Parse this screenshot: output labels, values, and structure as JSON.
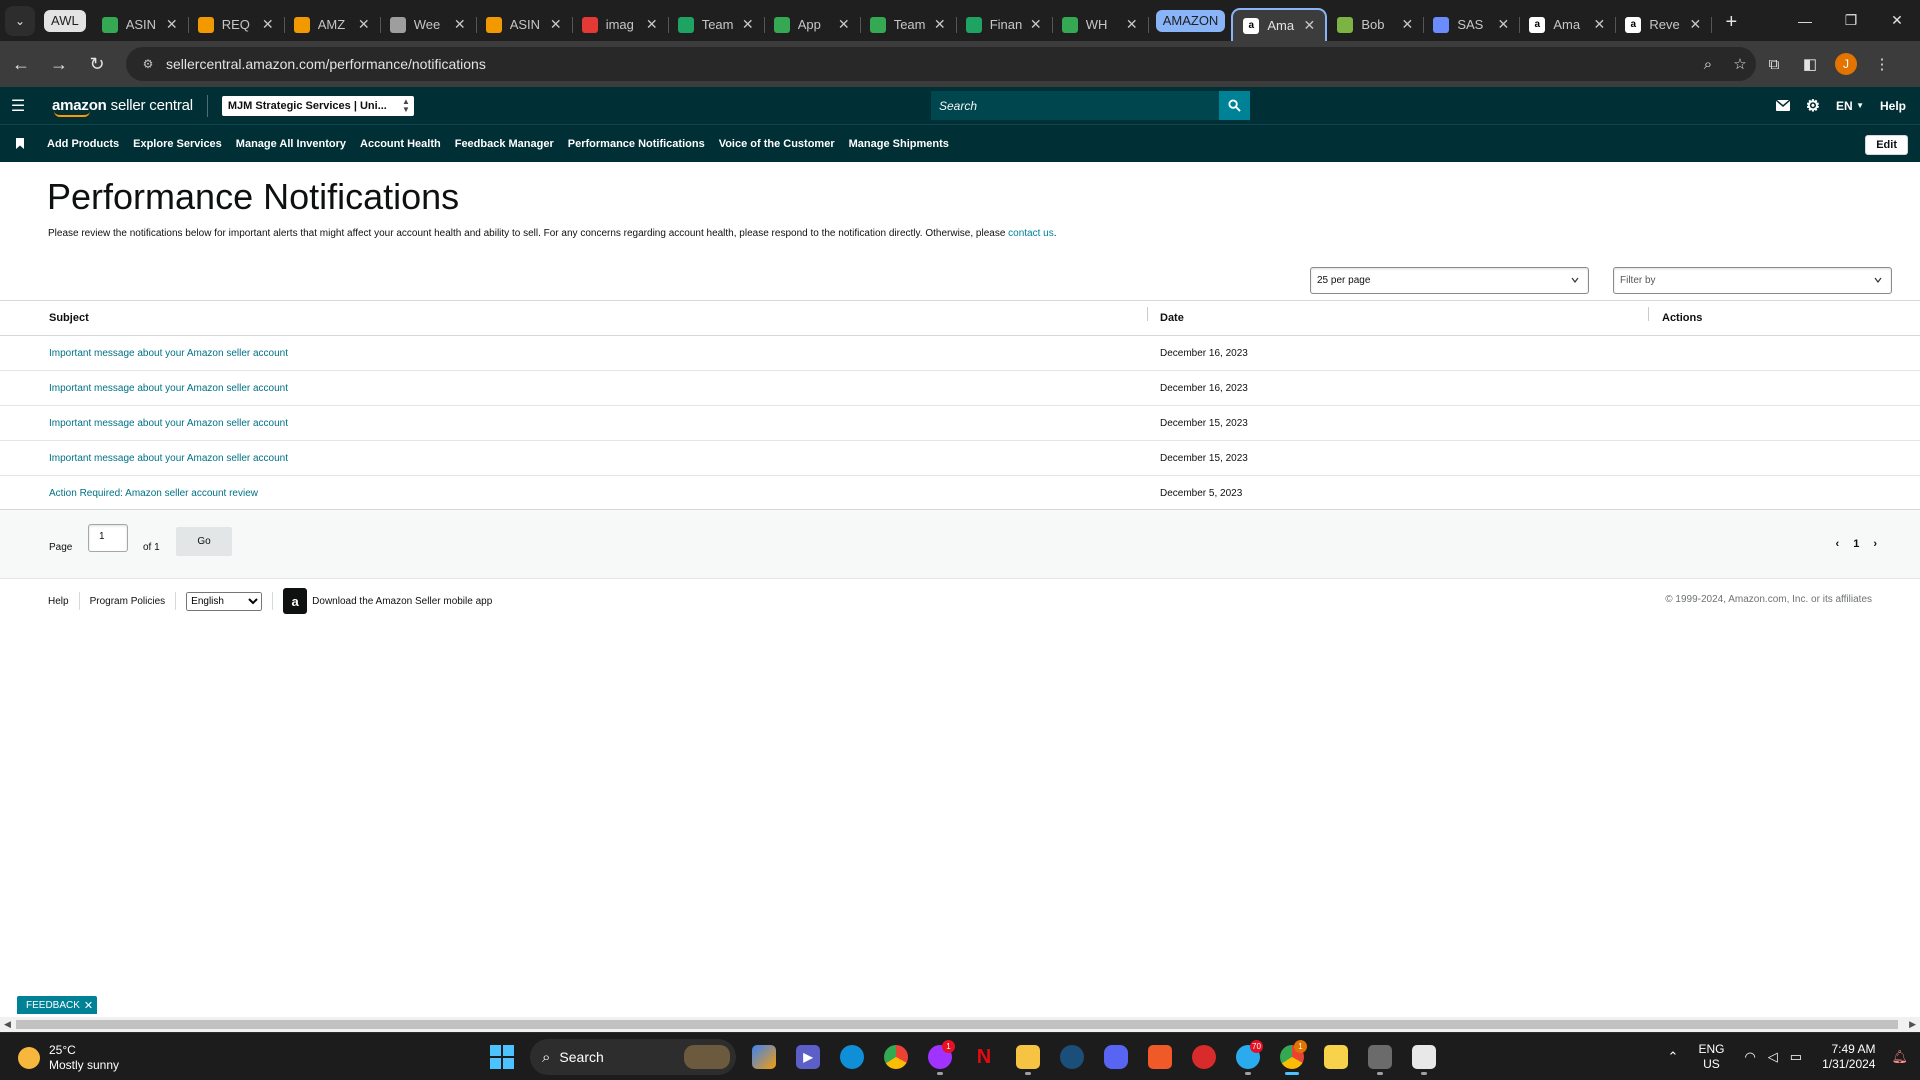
{
  "browser": {
    "tab_group_label": "AWL",
    "tabs": [
      {
        "title": "ASIN",
        "favicon": "sheets-green-icon",
        "color": "#34a853"
      },
      {
        "title": "REQ",
        "favicon": "pen-icon",
        "color": "#f29900"
      },
      {
        "title": "AMZ",
        "favicon": "pen-icon",
        "color": "#f29900"
      },
      {
        "title": "Wee",
        "favicon": "hub-icon",
        "color": "#9e9e9e"
      },
      {
        "title": "ASIN",
        "favicon": "hub-icon",
        "color": "#f29900"
      },
      {
        "title": "imag",
        "favicon": "pin-icon",
        "color": "#e53935"
      },
      {
        "title": "Team",
        "favicon": "sheets-plus-icon",
        "color": "#1ea362"
      },
      {
        "title": "App",
        "favicon": "sheets-green-icon",
        "color": "#34a853"
      },
      {
        "title": "Team",
        "favicon": "sheets-green-icon",
        "color": "#34a853"
      },
      {
        "title": "Finan",
        "favicon": "sheets-plus-icon",
        "color": "#1ea362"
      },
      {
        "title": "WH",
        "favicon": "sheets-green-icon",
        "color": "#34a853"
      }
    ],
    "tab_group2_label": "AMAZON",
    "tabs2": [
      {
        "title": "Ama",
        "favicon": "amazon-a-icon",
        "color": "#ffffff",
        "active": true
      },
      {
        "title": "Bob",
        "favicon": "bob-icon",
        "color": "#7cb342"
      },
      {
        "title": "SAS",
        "favicon": "sas-icon",
        "color": "#6b8cff"
      },
      {
        "title": "Ama",
        "favicon": "amazon-a-icon",
        "color": "#ffffff"
      },
      {
        "title": "Reve",
        "favicon": "amazon-a-icon",
        "color": "#ffffff"
      }
    ],
    "url": "sellercentral.amazon.com/performance/notifications",
    "profile_initial": "J"
  },
  "header": {
    "logo_bold": "amazon",
    "logo_light": "seller central",
    "account": "MJM Strategic Services | Uni...",
    "search_placeholder": "Search",
    "lang": "EN",
    "help": "Help"
  },
  "nav": {
    "items": [
      "Add Products",
      "Explore Services",
      "Manage All Inventory",
      "Account Health",
      "Feedback Manager",
      "Performance Notifications",
      "Voice of the Customer",
      "Manage Shipments"
    ],
    "edit": "Edit"
  },
  "page": {
    "title": "Performance Notifications",
    "description": "Please review the notifications below for important alerts that might affect your account health and ability to sell. For any concerns regarding account health, please respond to the notification directly. Otherwise, please ",
    "description_link": "contact us",
    "description_end": ".",
    "per_page": "25 per page",
    "filter_placeholder": "Filter by"
  },
  "table": {
    "headers": {
      "subject": "Subject",
      "date": "Date",
      "actions": "Actions"
    },
    "rows": [
      {
        "subject": "Important message about your Amazon seller account",
        "date": "December 16, 2023"
      },
      {
        "subject": "Important message about your Amazon seller account",
        "date": "December 16, 2023"
      },
      {
        "subject": "Important message about your Amazon seller account",
        "date": "December 15, 2023"
      },
      {
        "subject": "Important message about your Amazon seller account",
        "date": "December 15, 2023"
      },
      {
        "subject": "Action Required: Amazon seller account review",
        "date": "December 5, 2023"
      }
    ]
  },
  "pager": {
    "page_label": "Page",
    "page_value": "1",
    "of_label": "of 1",
    "go": "Go",
    "current": "1"
  },
  "footer": {
    "help": "Help",
    "policies": "Program Policies",
    "language": "English",
    "app": "Download the Amazon Seller mobile app",
    "copyright": "© 1999-2024, Amazon.com, Inc. or its affiliates"
  },
  "feedback": "FEEDBACK",
  "taskbar": {
    "temp": "25°C",
    "weather": "Mostly sunny",
    "search": "Search",
    "lang1": "ENG",
    "lang2": "US",
    "time": "7:49 AM",
    "date": "1/31/2024",
    "messenger_badge": "1",
    "telegram_badge": "70",
    "chrome_badge": "1"
  }
}
